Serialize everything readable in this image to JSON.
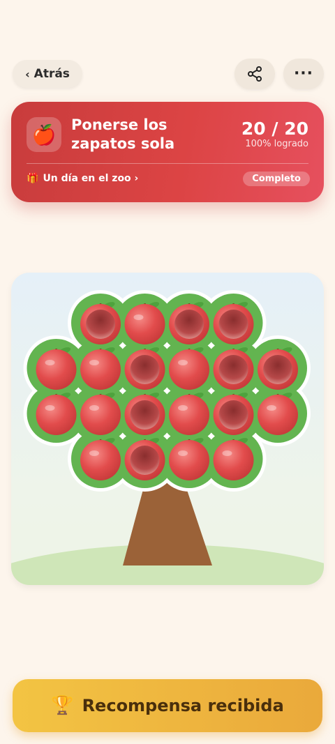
{
  "header": {
    "back_label": "Atrás",
    "back_chevron": "‹",
    "more_label": "···",
    "share_icon": "share-icon",
    "more_icon": "more-icon"
  },
  "goal": {
    "emoji": "🍎",
    "title": "Ponerse los zapatos sola",
    "count": "20 / 20",
    "percent": "100% logrado",
    "reward_emoji": "🎁",
    "reward_text": "Un día en el zoo ›",
    "status": "Completo",
    "accent_color": "#dc4444"
  },
  "tree": {
    "rows": [
      [
        "empty",
        "full",
        "empty",
        "empty"
      ],
      [
        "full",
        "full",
        "empty",
        "full",
        "empty",
        "empty"
      ],
      [
        "full",
        "full",
        "empty",
        "full",
        "empty",
        "full"
      ],
      [
        "full",
        "empty",
        "full",
        "full"
      ]
    ],
    "leaf_color": "#63b450",
    "apple_color": "#e14b4b"
  },
  "footer": {
    "trophy": "🏆",
    "button_label": "Recompensa recibida"
  }
}
